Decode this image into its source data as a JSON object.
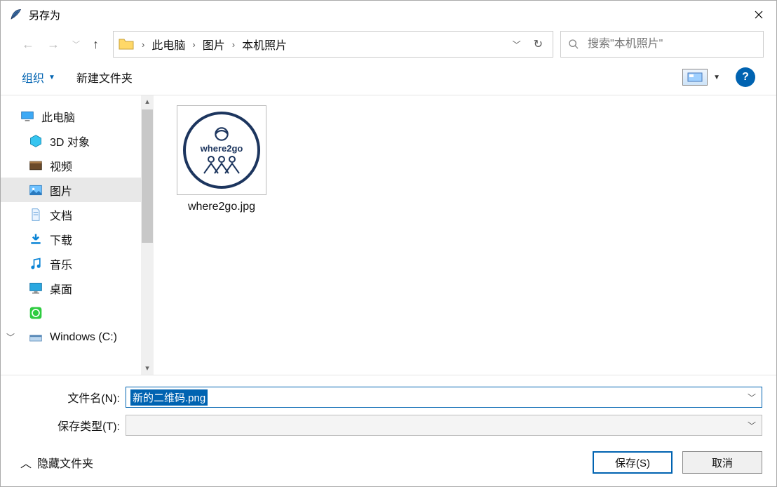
{
  "window": {
    "title": "另存为"
  },
  "nav": {
    "breadcrumb": [
      "此电脑",
      "图片",
      "本机照片"
    ],
    "search_placeholder": "搜索\"本机照片\""
  },
  "toolbar": {
    "organize": "组织",
    "new_folder": "新建文件夹"
  },
  "sidebar": {
    "items": [
      {
        "label": "此电脑",
        "icon": "pc",
        "root": true
      },
      {
        "label": "3D 对象",
        "icon": "cube"
      },
      {
        "label": "视频",
        "icon": "video"
      },
      {
        "label": "图片",
        "icon": "picture",
        "selected": true
      },
      {
        "label": "文档",
        "icon": "doc"
      },
      {
        "label": "下载",
        "icon": "download"
      },
      {
        "label": "音乐",
        "icon": "music"
      },
      {
        "label": "桌面",
        "icon": "desktop"
      },
      {
        "label": "",
        "icon": "app-green"
      },
      {
        "label": "Windows (C:)",
        "icon": "drive"
      }
    ]
  },
  "files": [
    {
      "label": "where2go.jpg",
      "thumb_text": "where2go"
    }
  ],
  "fields": {
    "filename_label": "文件名(N):",
    "filename_value": "新的二维码.png",
    "type_label": "保存类型(T):",
    "type_value": ""
  },
  "footer": {
    "hide_folders": "隐藏文件夹",
    "save": "保存(S)",
    "cancel": "取消"
  }
}
